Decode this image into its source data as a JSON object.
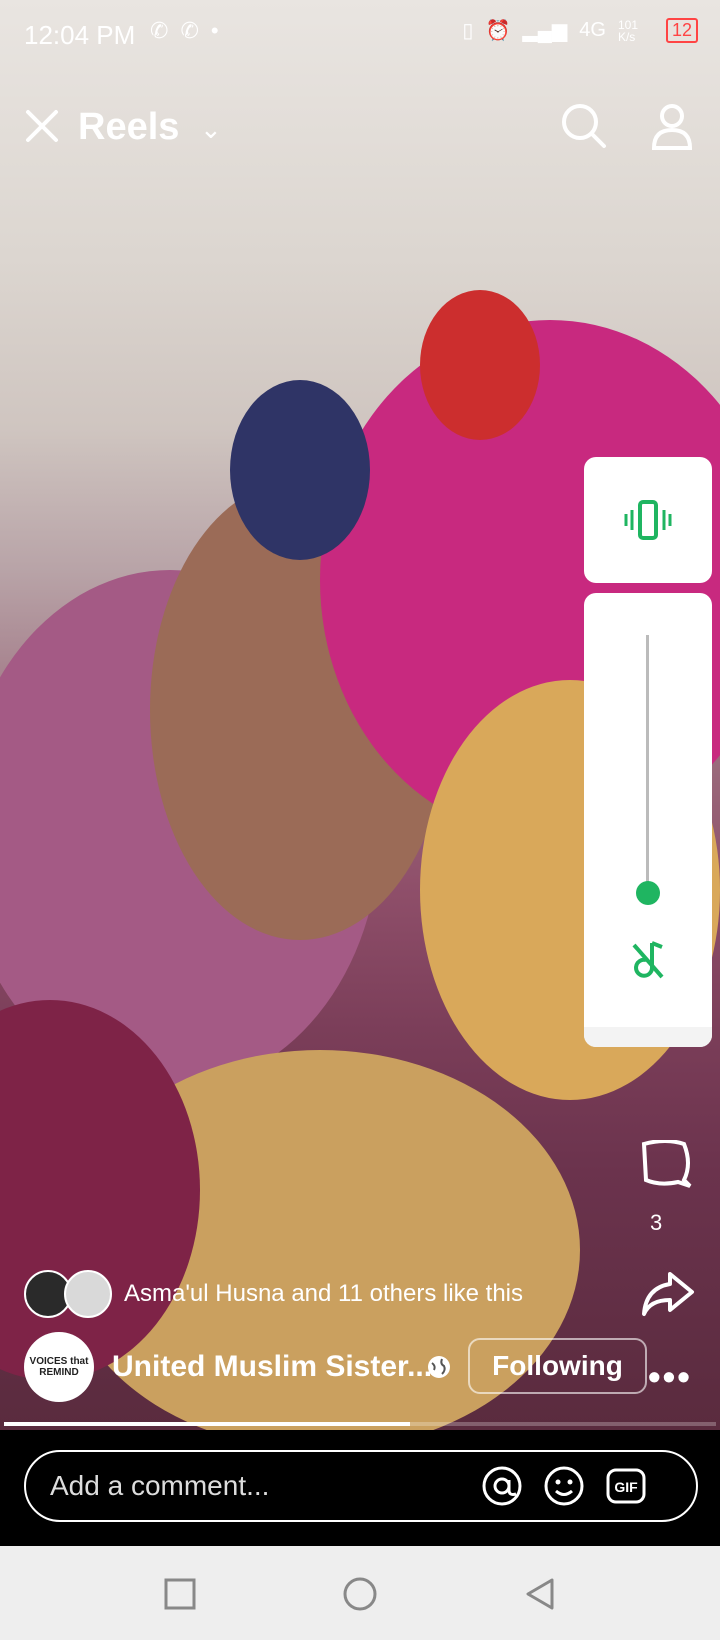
{
  "status_bar": {
    "time": "12:04 PM",
    "net_speed": "101 K/s",
    "network": "4G",
    "battery": "12"
  },
  "header": {
    "title": "Reels"
  },
  "likes": {
    "text": "Asma'ul Husna and 11 others like this"
  },
  "post": {
    "page_name": "United Muslim Sister...",
    "follow_label": "Following",
    "logo_text": "VOICES that REMIND"
  },
  "actions": {
    "comment_count": "3"
  },
  "comment_bar": {
    "placeholder": "Add a comment..."
  },
  "video": {
    "progress": 0.57
  }
}
